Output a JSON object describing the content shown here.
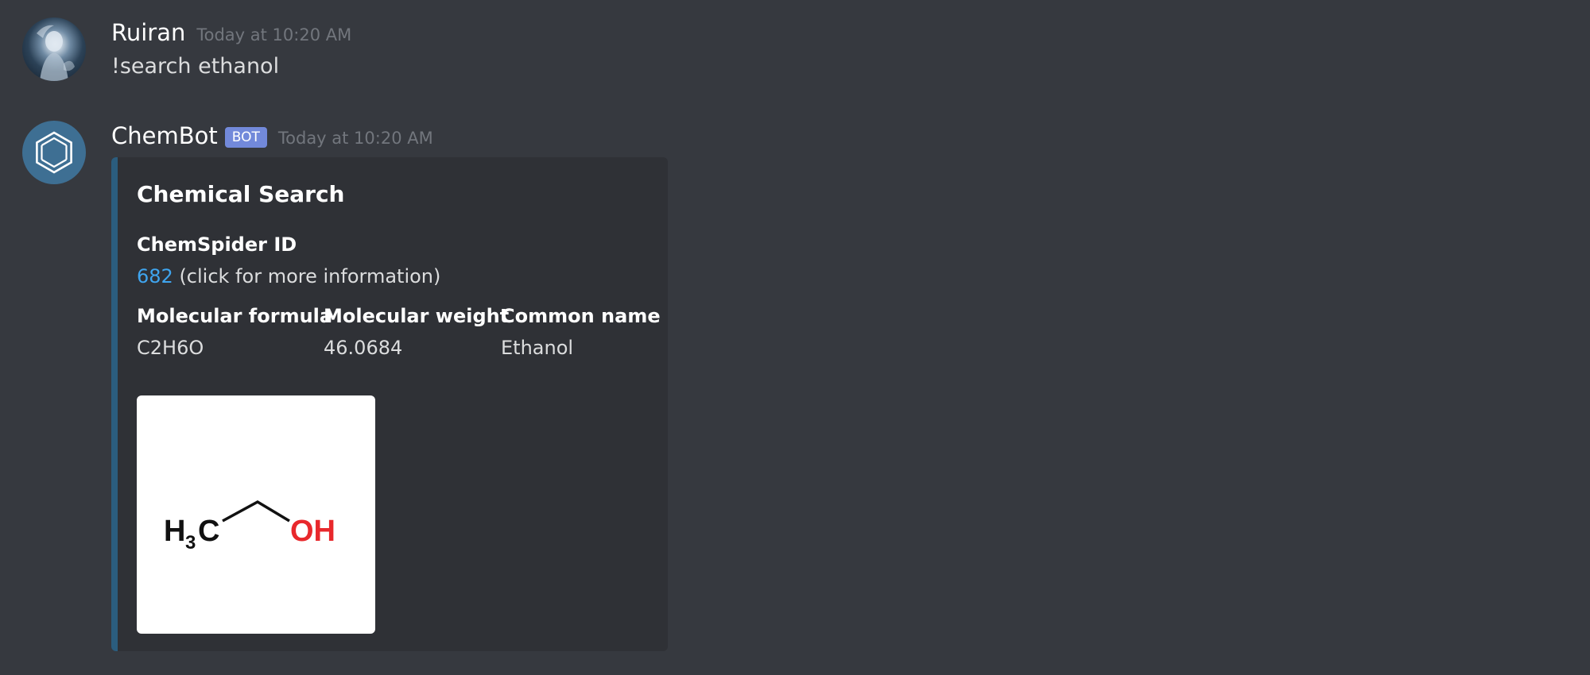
{
  "messages": {
    "user": {
      "username": "Ruiran",
      "timestamp": "Today at 10:20 AM",
      "text": "!search ethanol"
    },
    "bot": {
      "username": "ChemBot",
      "badge": "BOT",
      "timestamp": "Today at 10:20 AM",
      "embed": {
        "accent_color": "#2b5d7e",
        "title": "Chemical Search",
        "chemspider": {
          "name": "ChemSpider ID",
          "id_link": "682",
          "suffix": " (click for more information)"
        },
        "fields": [
          {
            "name": "Molecular formula",
            "value": "C2H6O"
          },
          {
            "name": "Molecular weight",
            "value": "46.0684"
          },
          {
            "name": "Common name",
            "value": "Ethanol"
          }
        ],
        "structure": {
          "left_group": "H",
          "left_subscript": "3",
          "left_tail": "C",
          "right_group": "OH"
        }
      }
    }
  },
  "colors": {
    "background": "#36393f",
    "embed_background": "#2f3136",
    "link": "#3fa5ef",
    "bot_badge": "#7289da",
    "bot_avatar": "#3e6f93",
    "hydroxyl": "#e8282c"
  },
  "icons": {
    "user_avatar": "user-avatar-photo",
    "bot_avatar": "benzene-hexagon-icon"
  }
}
